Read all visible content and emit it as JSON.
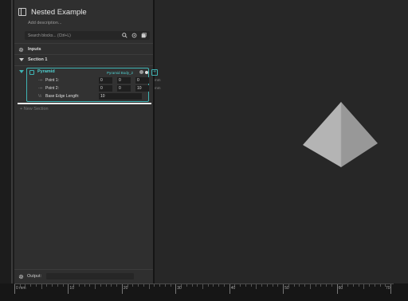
{
  "panel": {
    "title": "Nested Example",
    "description_placeholder": "Add description...",
    "search_placeholder": "Search blocks... (Ctrl+L)"
  },
  "sections": {
    "inputs_label": "Inputs",
    "section1_label": "Section 1",
    "new_section_label": "+ New Section"
  },
  "block": {
    "name": "Pyramid",
    "output_name": "Pyramid Body_2",
    "params": [
      {
        "label": "Point 1:",
        "values": [
          "0",
          "0",
          "0"
        ],
        "unit": "mm"
      },
      {
        "label": "Point 2:",
        "values": [
          "0",
          "0",
          "10"
        ],
        "unit": "mm"
      },
      {
        "label": "Base Edge Length:",
        "values": [
          "10"
        ],
        "unit": "mm"
      }
    ]
  },
  "output_bar": {
    "label": "Output:"
  },
  "ruler": {
    "labels": [
      "0 mm",
      "10",
      "20",
      "30",
      "40",
      "50",
      "60",
      "70"
    ]
  },
  "colors": {
    "accent": "#3fb3b3",
    "panel_bg": "#2f2f2f",
    "viewport_bg": "#272727"
  }
}
